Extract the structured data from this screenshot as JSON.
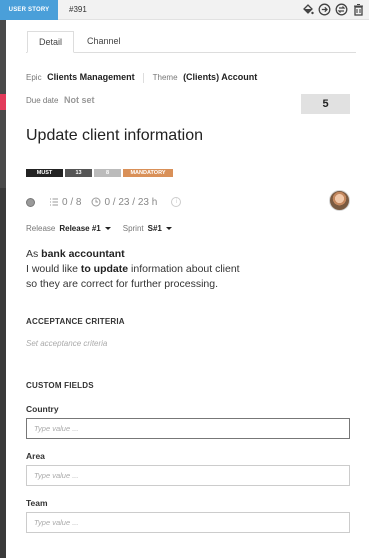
{
  "header": {
    "type_badge": "USER STORY",
    "item_id": "#391",
    "icons": [
      "paint-bucket-icon",
      "arrow-circle-right-icon",
      "swap-circle-icon",
      "trash-icon"
    ]
  },
  "tabs": [
    {
      "label": "Detail",
      "active": true
    },
    {
      "label": "Channel",
      "active": false
    }
  ],
  "epic": {
    "label": "Epic",
    "value": "Clients Management"
  },
  "theme": {
    "label": "Theme",
    "value": "(Clients) Account"
  },
  "due_date": {
    "label": "Due date",
    "value": "Not set"
  },
  "story_points": "5",
  "title": "Update client information",
  "tags": [
    "MUST",
    "13",
    "8",
    "MANDATORY"
  ],
  "stats": {
    "tasks": "0 / 8",
    "time": "0 / 23 / 23 h",
    "info": "i"
  },
  "release": {
    "label": "Release",
    "value": "Release #1"
  },
  "sprint": {
    "label": "Sprint",
    "value": "S#1"
  },
  "story": {
    "line1_prefix": "As ",
    "line1_bold": "bank accountant",
    "line2_prefix": "I would like ",
    "line2_bold": "to update",
    "line2_suffix": " information about client",
    "line3": "so they are correct for further processing."
  },
  "acceptance": {
    "heading": "ACCEPTANCE CRITERIA",
    "placeholder": "Set acceptance criteria"
  },
  "custom_fields": {
    "heading": "CUSTOM FIELDS",
    "fields": [
      {
        "label": "Country",
        "placeholder": "Type value ..."
      },
      {
        "label": "Area",
        "placeholder": "Type value ..."
      },
      {
        "label": "Team",
        "placeholder": "Type value ..."
      }
    ]
  },
  "colors": {
    "type_badge": "#4a9fd9",
    "mandatory_tag": "#d99058",
    "must_tag": "#222222",
    "left_accent": "#e23b5a"
  }
}
